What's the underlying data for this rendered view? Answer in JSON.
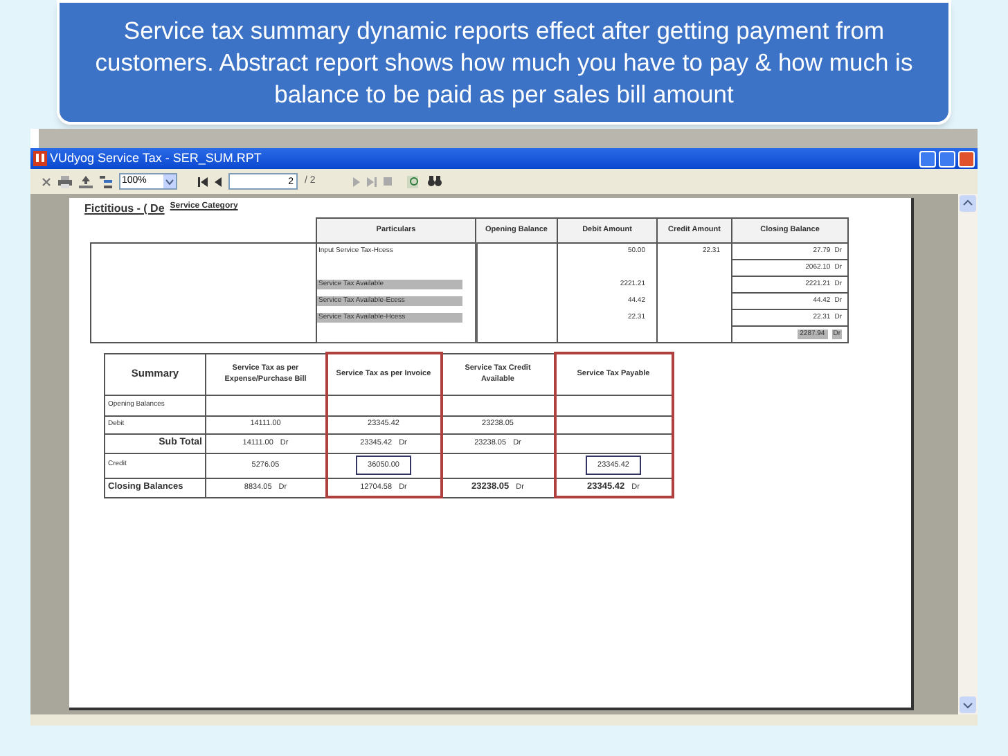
{
  "caption": "Service tax summary dynamic reports effect after getting payment from customers. Abstract report shows how much you have to pay & how much is balance to be paid as per sales bill amount",
  "window": {
    "title": "VUdyog Service Tax - SER_SUM.RPT"
  },
  "toolbar": {
    "zoom": "100%",
    "page": "2",
    "page_total": "/ 2"
  },
  "report": {
    "company": "Fictitious - ( De",
    "category_label": "Service Category",
    "columns": [
      "Particulars",
      "Opening Balance",
      "Debit Amount",
      "Credit Amount",
      "Closing Balance"
    ],
    "rows": [
      {
        "particulars": "Input Service Tax-Hcess",
        "shaded": false,
        "debit": "50.00",
        "credit": "22.31",
        "closing": "27.79",
        "side": "Dr",
        "closing_shaded": false
      },
      {
        "particulars": "",
        "shaded": false,
        "debit": "",
        "credit": "",
        "closing": "2062.10",
        "side": "Dr",
        "closing_shaded": false
      },
      {
        "particulars": "Service Tax Available",
        "shaded": true,
        "debit": "2221.21",
        "credit": "",
        "closing": "2221.21",
        "side": "Dr",
        "closing_shaded": false
      },
      {
        "particulars": "Service Tax Available-Ecess",
        "shaded": true,
        "debit": "44.42",
        "credit": "",
        "closing": "44.42",
        "side": "Dr",
        "closing_shaded": false
      },
      {
        "particulars": "Service Tax Available-Hcess",
        "shaded": true,
        "debit": "22.31",
        "credit": "",
        "closing": "22.31",
        "side": "Dr",
        "closing_shaded": false
      },
      {
        "particulars": "",
        "shaded": false,
        "debit": "",
        "credit": "",
        "closing": "2287.94",
        "side": "Dr",
        "closing_shaded": true
      }
    ]
  },
  "summary": {
    "columns": [
      {
        "label": "Summary",
        "highlighted": false
      },
      {
        "label": "Service Tax as per Expense/Purchase Bill",
        "highlighted": false
      },
      {
        "label": "Service Tax as per Invoice",
        "highlighted": true
      },
      {
        "label": "Service Tax Credit Available",
        "highlighted": false
      },
      {
        "label": "Service Tax Payable",
        "highlighted": true
      }
    ],
    "rows": [
      {
        "kind": "note",
        "cells": [
          {
            "text": "Opening Balances"
          },
          {},
          {},
          {},
          {}
        ]
      },
      {
        "kind": "note",
        "cells": [
          {
            "text": "Debit"
          },
          {
            "amount": "14111.00",
            "boxed": false,
            "bold": false
          },
          {
            "amount": "23345.42",
            "boxed": false,
            "bold": false
          },
          {
            "amount": "23238.05",
            "boxed": false,
            "bold": false
          },
          {}
        ]
      },
      {
        "kind": "subtotal",
        "cells": [
          {
            "text": "Sub Total"
          },
          {
            "amount": "14111.00",
            "side": "Dr",
            "boxed": false,
            "bold": false
          },
          {
            "amount": "23345.42",
            "side": "Dr",
            "boxed": false,
            "bold": false
          },
          {
            "amount": "23238.05",
            "side": "Dr",
            "boxed": false,
            "bold": false
          },
          {}
        ]
      },
      {
        "kind": "note",
        "cells": [
          {
            "text": "Credit"
          },
          {
            "amount": "5276.05",
            "boxed": false,
            "bold": false
          },
          {
            "amount": "36050.00",
            "boxed": true,
            "bold": false
          },
          {},
          {
            "amount": "23345.42",
            "boxed": true,
            "bold": false
          }
        ]
      },
      {
        "kind": "total",
        "cells": [
          {
            "text": "Closing Balances"
          },
          {
            "amount": "8834.05",
            "side": "Dr",
            "boxed": false,
            "bold": false
          },
          {
            "amount": "12704.58",
            "side": "Dr",
            "boxed": false,
            "bold": false
          },
          {
            "amount": "23238.05",
            "side": "Dr",
            "boxed": false,
            "bold": true
          },
          {
            "amount": "23345.42",
            "side": "Dr",
            "boxed": false,
            "bold": true
          }
        ]
      }
    ]
  }
}
